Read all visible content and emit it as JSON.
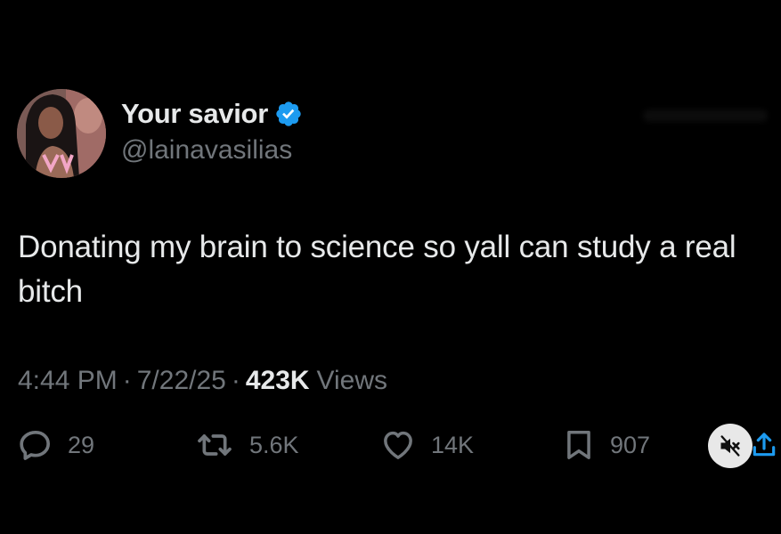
{
  "author": {
    "display_name": "Your savior",
    "handle": "@lainavasilias",
    "verified_icon": "verified-badge-icon"
  },
  "tweet": {
    "text": "Donating my brain to science so yall can study a real bitch"
  },
  "meta": {
    "time": "4:44 PM",
    "separator": "·",
    "date": "7/22/25",
    "views_count": "423K",
    "views_label": "Views"
  },
  "actions": {
    "replies": "29",
    "reposts": "5.6K",
    "likes": "14K",
    "bookmarks": "907"
  },
  "colors": {
    "background": "#000000",
    "text_primary": "#e7e9ea",
    "text_secondary": "#71767b",
    "verified": "#1d9bf0"
  }
}
